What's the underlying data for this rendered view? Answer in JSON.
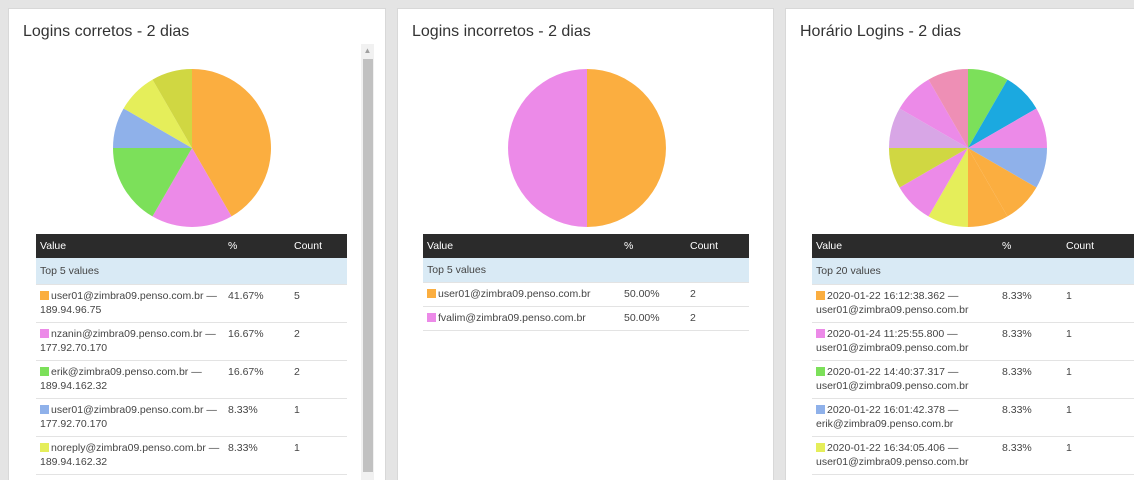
{
  "headers": {
    "value": "Value",
    "percent": "%",
    "count": "Count"
  },
  "panels": [
    {
      "title": "Logins corretos - 2 dias",
      "group_label": "Top 5 values",
      "rows": [
        {
          "color": "#fbae40",
          "text": "user01@zimbra09.penso.com.br — 189.94.96.75",
          "pct": "41.67%",
          "count": "5"
        },
        {
          "color": "#ec8ae8",
          "text": "nzanin@zimbra09.penso.com.br — 177.92.70.170",
          "pct": "16.67%",
          "count": "2"
        },
        {
          "color": "#7ce05a",
          "text": "erik@zimbra09.penso.com.br — 189.94.162.32",
          "pct": "16.67%",
          "count": "2"
        },
        {
          "color": "#8fb1ea",
          "text": "user01@zimbra09.penso.com.br — 177.92.70.170",
          "pct": "8.33%",
          "count": "1"
        },
        {
          "color": "#e5ee5a",
          "text": "noreply@zimbra09.penso.com.br — 189.94.162.32",
          "pct": "8.33%",
          "count": "1"
        }
      ],
      "chart_data": {
        "type": "pie",
        "slices": [
          {
            "value": 41.67,
            "color": "#fbae40"
          },
          {
            "value": 16.67,
            "color": "#ec8ae8"
          },
          {
            "value": 16.67,
            "color": "#7ce05a"
          },
          {
            "value": 8.33,
            "color": "#8fb1ea"
          },
          {
            "value": 8.33,
            "color": "#e5ee5a"
          },
          {
            "value": 8.33,
            "color": "#d0d742"
          }
        ]
      }
    },
    {
      "title": "Logins incorretos - 2 dias",
      "group_label": "Top 5 values",
      "rows": [
        {
          "color": "#fbae40",
          "text": "user01@zimbra09.penso.com.br",
          "pct": "50.00%",
          "count": "2"
        },
        {
          "color": "#ec8ae8",
          "text": "fvalim@zimbra09.penso.com.br",
          "pct": "50.00%",
          "count": "2"
        }
      ],
      "chart_data": {
        "type": "pie",
        "slices": [
          {
            "value": 50,
            "color": "#fbae40"
          },
          {
            "value": 50,
            "color": "#ec8ae8"
          }
        ]
      }
    },
    {
      "title": "Horário Logins - 2 dias",
      "group_label": "Top 20 values",
      "rows": [
        {
          "color": "#fbae40",
          "text": "2020-01-22 16:12:38.362 — user01@zimbra09.penso.com.br",
          "pct": "8.33%",
          "count": "1"
        },
        {
          "color": "#ec8ae8",
          "text": "2020-01-24 11:25:55.800 — user01@zimbra09.penso.com.br",
          "pct": "8.33%",
          "count": "1"
        },
        {
          "color": "#7ce05a",
          "text": "2020-01-22 14:40:37.317 — user01@zimbra09.penso.com.br",
          "pct": "8.33%",
          "count": "1"
        },
        {
          "color": "#8fb1ea",
          "text": "2020-01-22 16:01:42.378 — erik@zimbra09.penso.com.br",
          "pct": "8.33%",
          "count": "1"
        },
        {
          "color": "#e5ee5a",
          "text": "2020-01-22 16:34:05.406 — user01@zimbra09.penso.com.br",
          "pct": "8.33%",
          "count": "1"
        }
      ],
      "chart_data": {
        "type": "pie",
        "slices": [
          {
            "value": 8.33,
            "color": "#7ce05a"
          },
          {
            "value": 8.33,
            "color": "#1ba9e0"
          },
          {
            "value": 8.33,
            "color": "#ec8ae8"
          },
          {
            "value": 8.33,
            "color": "#8fb1ea"
          },
          {
            "value": 8.33,
            "color": "#fbae40"
          },
          {
            "value": 8.33,
            "color": "#fbae40"
          },
          {
            "value": 8.33,
            "color": "#e5ee5a"
          },
          {
            "value": 8.33,
            "color": "#ec8ae8"
          },
          {
            "value": 8.33,
            "color": "#d0d742"
          },
          {
            "value": 8.33,
            "color": "#d8a6e6"
          },
          {
            "value": 8.33,
            "color": "#ec8ae8"
          },
          {
            "value": 8.33,
            "color": "#ee8fb5"
          }
        ]
      }
    }
  ]
}
